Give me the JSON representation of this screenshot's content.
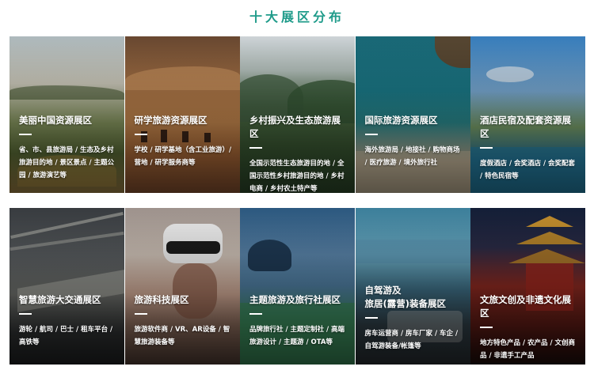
{
  "page": {
    "title": "十大展区分布"
  },
  "zones": [
    {
      "title": "美丽中国资源展区",
      "desc": "省、市、县旅游局 / 生态及乡村旅游目的地 / 景区景点 / 主题公园 / 旅游演艺等",
      "image": "farmland-landscape"
    },
    {
      "title": "研学旅游资源展区",
      "desc": "学校 / 研学基地（含工业旅游）/ 营地 / 研学服务商等",
      "image": "desert-camels"
    },
    {
      "title": "乡村振兴及生态旅游展区",
      "desc": "全国示范性生态旅游目的地 / 全国示范性乡村旅游目的地 / 乡村电商 / 乡村农土特产等",
      "image": "mountain-valley"
    },
    {
      "title": "国际旅游资源展区",
      "desc": "海外旅游局 / 地接社 / 购物商场 / 医疗旅游 / 境外旅行社",
      "image": "beach-cliff"
    },
    {
      "title": "酒店民宿及配套资源展区",
      "desc": "度假酒店 / 会奖酒店 / 会奖配套 / 特色民宿等",
      "image": "infinity-pool"
    },
    {
      "title": "智慧旅游大交通展区",
      "desc": "游轮 / 航司 / 巴士 / 租车平台 / 高铁等",
      "image": "high-speed-train"
    },
    {
      "title": "旅游科技展区",
      "desc": "旅游软件商 / VR、AR设备 / 智慧旅游装备等",
      "image": "vr-headset"
    },
    {
      "title": "主题旅游及旅行社展区",
      "desc": "品牌旅行社 / 主题定制社 / 高端旅游设计 / 主题游 / OTA等",
      "image": "traveler-photo"
    },
    {
      "title": "自驾游及\n旅居(露营)装备展区",
      "desc": "房车运营商 / 房车厂家 / 车企 / 自驾游装备/帐篷等",
      "image": "rv-sea"
    },
    {
      "title": "文旅文创及非遗文化展区",
      "desc": "地方特色产品 / 农产品 / 文创商品 / 非遗手工产品",
      "image": "ancient-pavilion"
    }
  ]
}
